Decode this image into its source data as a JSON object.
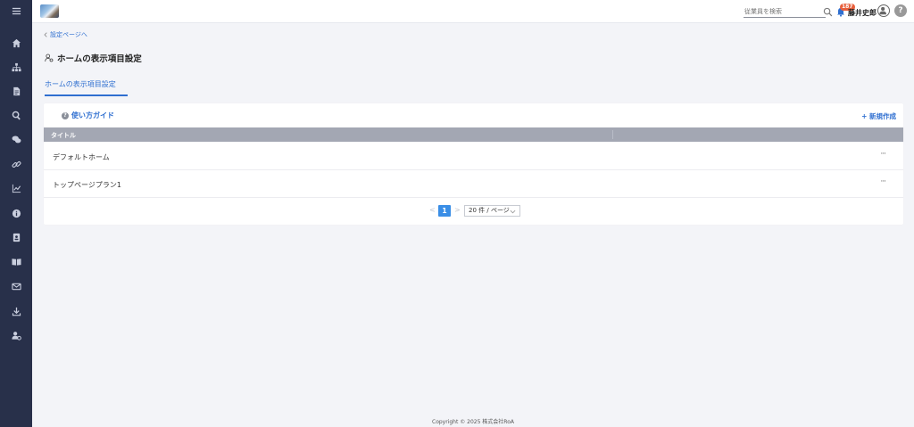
{
  "header": {
    "search_placeholder": "従業員を検索",
    "notification_count": "187",
    "user_name": "藤井史郎",
    "help_label": "?"
  },
  "sidebar": {
    "items": [
      {
        "icon": "menu-icon"
      },
      {
        "icon": "home-icon"
      },
      {
        "icon": "org-chart-icon"
      },
      {
        "icon": "document-icon"
      },
      {
        "icon": "search-icon"
      },
      {
        "icon": "chat-icon"
      },
      {
        "icon": "link-icon"
      },
      {
        "icon": "chart-icon"
      },
      {
        "icon": "info-icon"
      },
      {
        "icon": "contact-card-icon"
      },
      {
        "icon": "book-icon"
      },
      {
        "icon": "mail-icon"
      },
      {
        "icon": "download-icon"
      },
      {
        "icon": "user-settings-icon"
      }
    ]
  },
  "breadcrumb": {
    "back_label": "設定ページへ"
  },
  "page": {
    "title": "ホームの表示項目設定",
    "tab_label": "ホームの表示項目設定"
  },
  "panel": {
    "guide_label": "使い方ガイド",
    "new_label": "+ 新規作成",
    "table": {
      "header_title": "タイトル",
      "rows": [
        {
          "title": "デフォルトホーム",
          "more": "···"
        },
        {
          "title": "トップページプラン1",
          "more": "···"
        }
      ]
    },
    "pagination": {
      "prev": "<",
      "current": "1",
      "next": ">",
      "page_size": "20 件 / ページ"
    }
  },
  "footer": {
    "copyright": "Copyright © 2025 株式会社RoA"
  },
  "colors": {
    "sidebar_bg": "#28304a",
    "accent": "#2f6fd0",
    "table_header_bg": "#a3a7b3",
    "badge": "#e8603c",
    "page_bg": "#f3f4f8"
  }
}
